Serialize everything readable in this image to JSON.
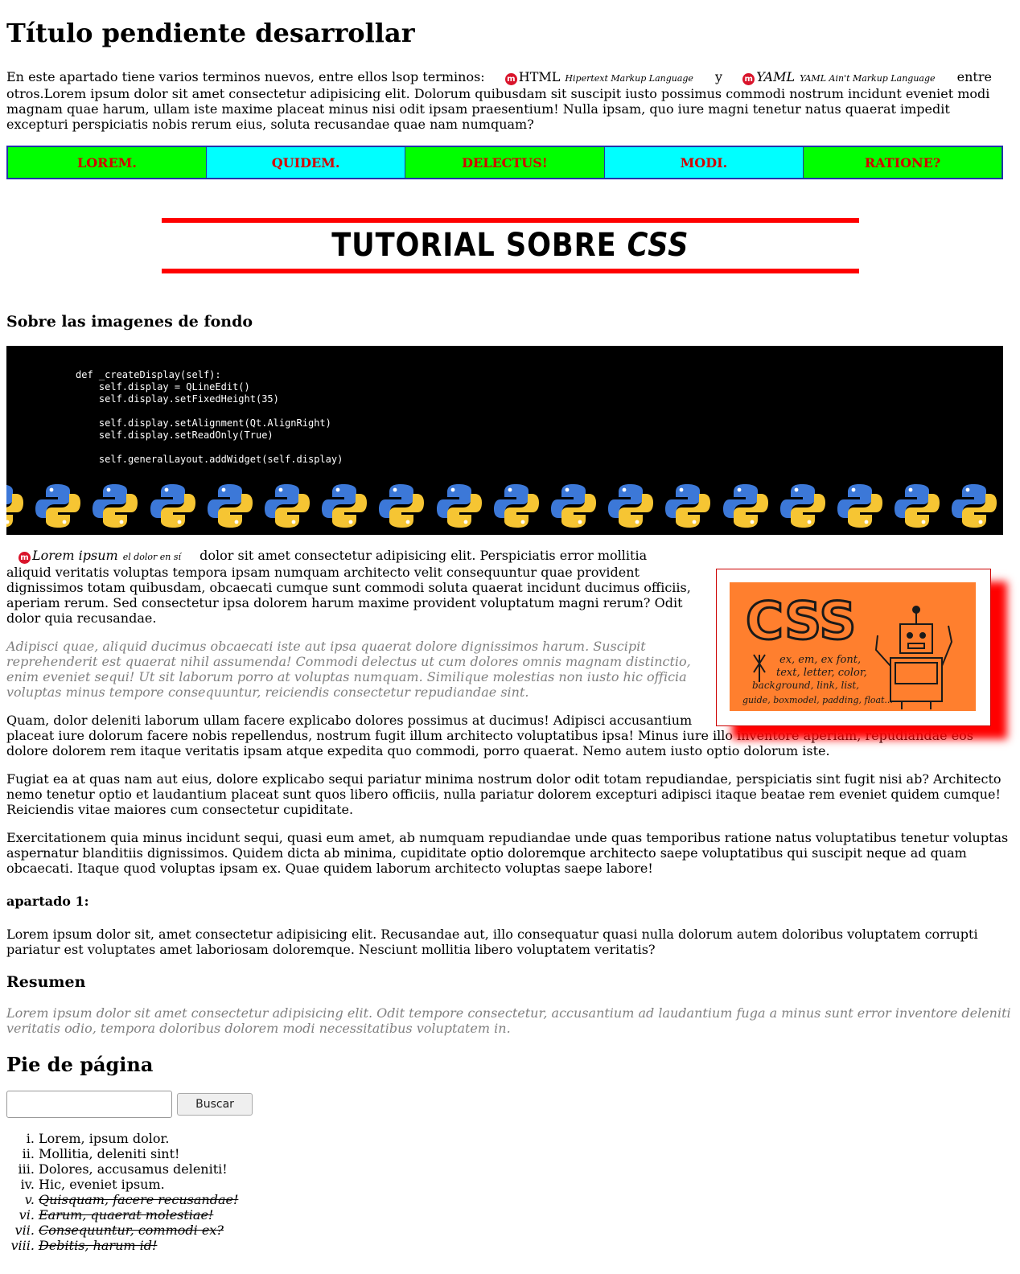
{
  "page": {
    "title": "Título pendiente desarrollar"
  },
  "intro": {
    "text_before": "En este apartado tiene varios terminos nuevos, entre ellos lsop terminos:",
    "term1_abbr": "HTML",
    "term1_def": "Hipertext Markup Language",
    "conj": "y",
    "term2_abbr": "YAML",
    "term2_def": "YAML Ain't Markup Language",
    "text_after": "entre otros.Lorem ipsum dolor sit amet consectetur adipisicing elit. Dolorum quibusdam sit suscipit iusto possimus commodi nostrum incidunt eveniet modi magnam quae harum, ullam iste maxime placeat minus nisi odit ipsam praesentium! Nulla ipsam, quo iure magni tenetur natus quaerat impedit excepturi perspiciatis nobis rerum eius, soluta recusandae quae nam numquam?"
  },
  "nav": {
    "items": [
      "LOREM.",
      "QUIDEM.",
      "DELECTUS!",
      "MODI.",
      "RATIONE?"
    ]
  },
  "banner": {
    "text": "TUTORIAL SOBRE",
    "text_css": "CSS"
  },
  "section": {
    "heading": "Sobre las imagenes de fondo"
  },
  "code": {
    "text": "def _createDisplay(self):\n    self.display = QLineEdit()\n    self.display.setFixedHeight(35)\n\n    self.display.setAlignment(Qt.AlignRight)\n    self.display.setReadOnly(True)\n\n    self.generalLayout.addWidget(self.display)"
  },
  "article": {
    "lead_term": "Lorem ipsum",
    "lead_def": "el dolor en sí",
    "p1_rest": "dolor sit amet consectetur adipisicing elit. Perspiciatis error mollitia aliquid veritatis voluptas tempora ipsam numquam architecto velit consequuntur quae provident dignissimos totam quibusdam, obcaecati cumque sunt commodi soluta quaerat incidunt ducimus officiis, aperiam rerum. Sed consectetur ipsa dolorem harum maxime provident voluptatum magni rerum? Odit dolor quia recusandae.",
    "p2": "Adipisci quae, aliquid ducimus obcaecati iste aut ipsa quaerat dolore dignissimos harum. Suscipit reprehenderit est quaerat nihil assumenda! Commodi delectus ut cum dolores omnis magnam distinctio, enim eveniet sequi! Ut sit laborum porro at voluptas numquam. Similique molestias non iusto hic officia voluptas minus tempore consequuntur, reiciendis consectetur repudiandae sint.",
    "p3": "Quam, dolor deleniti laborum ullam facere explicabo dolores possimus at ducimus! Adipisci accusantium placeat iure dolorum facere nobis repellendus, nostrum fugit illum architecto voluptatibus ipsa! Minus iure illo inventore aperiam, repudiandae eos dolore dolorem rem itaque veritatis ipsam atque expedita quo commodi, porro quaerat. Nemo autem iusto optio dolorum iste.",
    "p4": "Fugiat ea at quas nam aut eius, dolore explicabo sequi pariatur minima nostrum dolor odit totam repudiandae, perspiciatis sint fugit nisi ab? Architecto nemo tenetur optio et laudantium placeat sunt quos libero officiis, nulla pariatur dolorem excepturi adipisci itaque beatae rem eveniet quidem cumque! Reiciendis vitae maiores cum consectetur cupiditate.",
    "p5": "Exercitationem quia minus incidunt sequi, quasi eum amet, ab numquam repudiandae unde quas temporibus ratione natus voluptatibus tenetur voluptas aspernatur blanditiis dignissimos. Quidem dicta ab minima, cupiditate optio doloremque architecto saepe voluptatibus qui suscipit neque ad quam obcaecati. Itaque quod voluptas ipsam ex. Quae quidem laborum architecto voluptas saepe labore!"
  },
  "figure": {
    "word": "CSS",
    "line1": "ex, em, ex font,",
    "line2": "text, letter, color,",
    "line3": "background, link, list,",
    "line4": "guide, boxmodel, padding, float...",
    "bg_color": "#ff7f2e"
  },
  "apartado": {
    "heading": "apartado 1:",
    "text": "Lorem ipsum dolor sit, amet consectetur adipisicing elit. Recusandae aut, illo consequatur quasi nulla dolorum autem doloribus voluptatem corrupti pariatur est voluptates amet laboriosam doloremque. Nesciunt mollitia libero voluptatem veritatis?"
  },
  "resumen": {
    "heading": "Resumen",
    "text": "Lorem ipsum dolor sit amet consectetur adipisicing elit. Odit tempore consectetur, accusantium ad laudantium fuga a minus sunt error inventore deleniti veritatis odio, tempora doloribus dolorem modi necessitatibus voluptatem in."
  },
  "footer": {
    "heading": "Pie de página",
    "search_value": "",
    "search_button": "Buscar",
    "list": [
      {
        "text": "Lorem, ipsum dolor.",
        "struck": false
      },
      {
        "text": "Mollitia, deleniti sint!",
        "struck": false
      },
      {
        "text": "Dolores, accusamus deleniti!",
        "struck": false
      },
      {
        "text": "Hic, eveniet ipsum.",
        "struck": false
      },
      {
        "text": "Quisquam, facere recusandae!",
        "struck": true
      },
      {
        "text": "Earum, quaerat molestiae!",
        "struck": true
      },
      {
        "text": "Consequuntur, commodi ex?",
        "struck": true
      },
      {
        "text": "Debitis, harum id!",
        "struck": true
      }
    ]
  },
  "colors": {
    "nav_green": "#00ff00",
    "nav_cyan": "#00ffff",
    "nav_text": "#d40000",
    "banner_lines": "#ff0000",
    "python_blue": "#3c78d8",
    "python_yellow": "#f6c533"
  },
  "icons": {
    "term_icon": "medium-circle-icon",
    "snake_icon": "python-logo-icon"
  }
}
